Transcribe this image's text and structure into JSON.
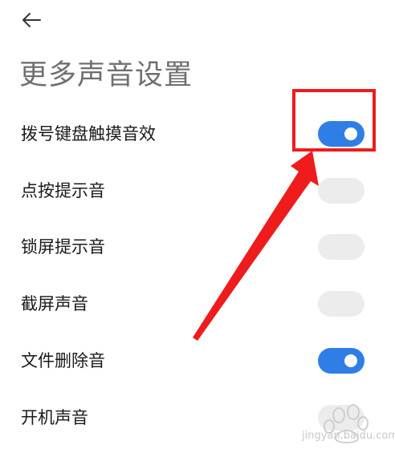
{
  "header": {
    "back_icon": "arrow-left-icon",
    "title": "更多声音设置"
  },
  "settings": [
    {
      "label": "拨号键盘触摸音效",
      "enabled": true
    },
    {
      "label": "点按提示音",
      "enabled": false
    },
    {
      "label": "锁屏提示音",
      "enabled": false
    },
    {
      "label": "截屏声音",
      "enabled": false
    },
    {
      "label": "文件删除音",
      "enabled": true
    },
    {
      "label": "开机声音",
      "enabled": false
    }
  ],
  "annotation": {
    "highlight_color": "#ee1c1c",
    "arrow_color": "#ee1c1c"
  },
  "watermark": {
    "text": "jingyan.baidu.com"
  },
  "colors": {
    "toggle_on": "#2f7ee6",
    "toggle_off": "#ececec"
  }
}
